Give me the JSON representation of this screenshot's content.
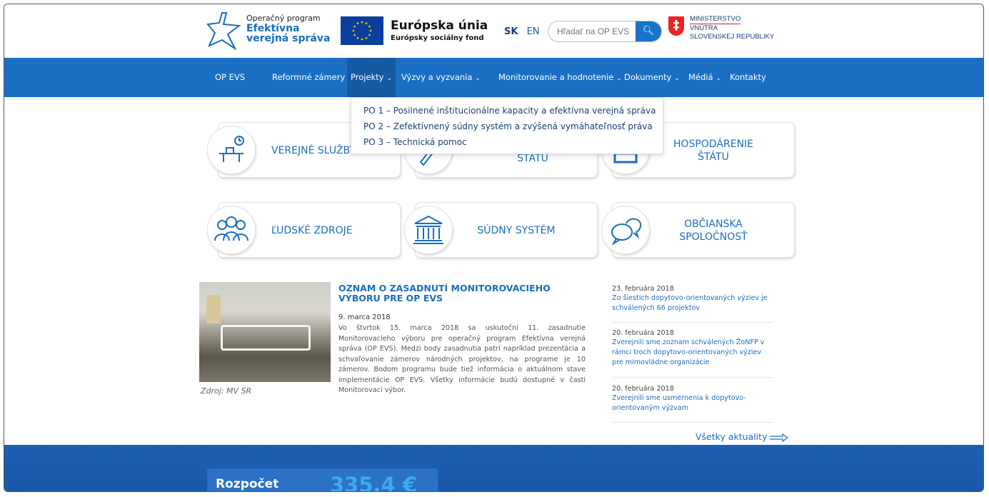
{
  "header": {
    "program_line1": "Operačný program",
    "program_line2": "Efektívna",
    "program_line3": "verejná správa",
    "eu_title": "Európska únia",
    "eu_sub": "Európsky sociálny fond",
    "lang_sk": "SK",
    "lang_en": "EN",
    "search_placeholder": "Hľadať na OP EVS",
    "ministry_line1": "MINISTERSTVO",
    "ministry_line2": "VNÚTRA",
    "ministry_line3": "SLOVENSKEJ REPUBLIKY"
  },
  "nav": {
    "items": [
      {
        "label": "OP EVS"
      },
      {
        "label": "Reformné zámery"
      },
      {
        "label": "Projekty"
      },
      {
        "label": "Výzvy a vyzvania"
      },
      {
        "label": "Monitorovanie a hodnotenie"
      },
      {
        "label": "Dokumenty"
      },
      {
        "label": "Médiá"
      },
      {
        "label": "Kontakty"
      }
    ],
    "chevron": "⌄"
  },
  "dropdown": {
    "items": [
      "PO 1 – Posilnené inštitucionálne kapacity a efektívna verejná správa",
      "PO 2 – Zefektívnený súdny systém a zvýšená vymáhateľnosť práva",
      "PO 3 – Technická pomoc"
    ]
  },
  "cards": {
    "public_services": "VEREJNÉ SLUŽBY",
    "state_line2": "ŠTÁTU",
    "finance_line1": "HOSPODÁRENIE",
    "finance_line2": "ŠTÁTU",
    "human_resources": "ĽUDSKÉ ZDROJE",
    "justice": "SÚDNY SYSTÉM",
    "civil_line1": "OBČIANSKA",
    "civil_line2": "SPOLOČNOSŤ"
  },
  "news": {
    "title": "OZNAM O ZASADNUTÍ MONITOROVACIEHO VÝBORU PRE OP EVS",
    "date": "9. marca 2018",
    "body": "Vo štvrtok 15. marca 2018 sa uskutoční 11. zasadnutie Monitorovacieho výboru pre operačný program Efektívna verejná správa (OP EVS). Medzi body zasadnutia patrí napríklad prezentácia a schvaľovanie zámerov národných projektov, na programe je 10 zámerov. Bodom programu bude tiež informácia o aktuálnom stave implementácie OP EVS. Všetky informácie budú dostupné v časti Monitorovací výbor.",
    "photo_caption": "Zdroj: MV SR"
  },
  "sidebar_news": [
    {
      "date": "23. februára 2018",
      "text": "Zo šiestich dopytovo-orientovaných výziev je schválených 66 projektov"
    },
    {
      "date": "20. februára 2018",
      "text": "Zverejnili sme zoznam schválených ŽoNFP v rámci troch dopytovo-orientovaných výziev pre mimovládne organizácie"
    },
    {
      "date": "20. februára 2018",
      "text": "Zverejnili sme usmernenia k dopytovo-orientovaným výzvam"
    }
  ],
  "all_news_link": "Všetky aktuality",
  "budget": {
    "label": "Rozpočet",
    "value": "335,4 €"
  },
  "colors": {
    "primary": "#1a6fc4",
    "nav_active": "#155aa3",
    "link": "#1a6ec0",
    "footer": "#1d5fb3"
  }
}
